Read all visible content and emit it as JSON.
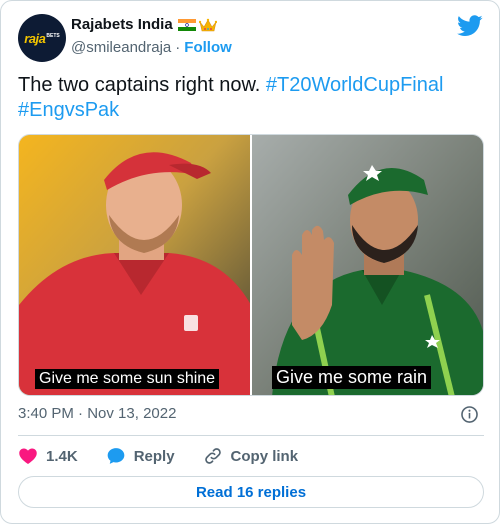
{
  "header": {
    "display_name": "Rajabets India",
    "handle": "@smileandraja",
    "separator": "·",
    "follow_label": "Follow",
    "avatar_logo": "raja",
    "avatar_logo_sub": "BETS"
  },
  "tweet": {
    "text": "The two captains right now.",
    "hashtags": [
      "#T20WorldCupFinal",
      "#EngvsPak"
    ]
  },
  "media": {
    "left_caption": "Give me some sun shine",
    "right_caption": "Give me some rain"
  },
  "meta": {
    "time": "3:40 PM",
    "separator": "·",
    "date": "Nov 13, 2022"
  },
  "actions": {
    "likes": "1.4K",
    "reply_label": "Reply",
    "copy_link_label": "Copy link"
  },
  "read_replies_label": "Read 16 replies",
  "colors": {
    "accent": "#1d9bf0",
    "like": "#f91880",
    "text_secondary": "#536471"
  }
}
